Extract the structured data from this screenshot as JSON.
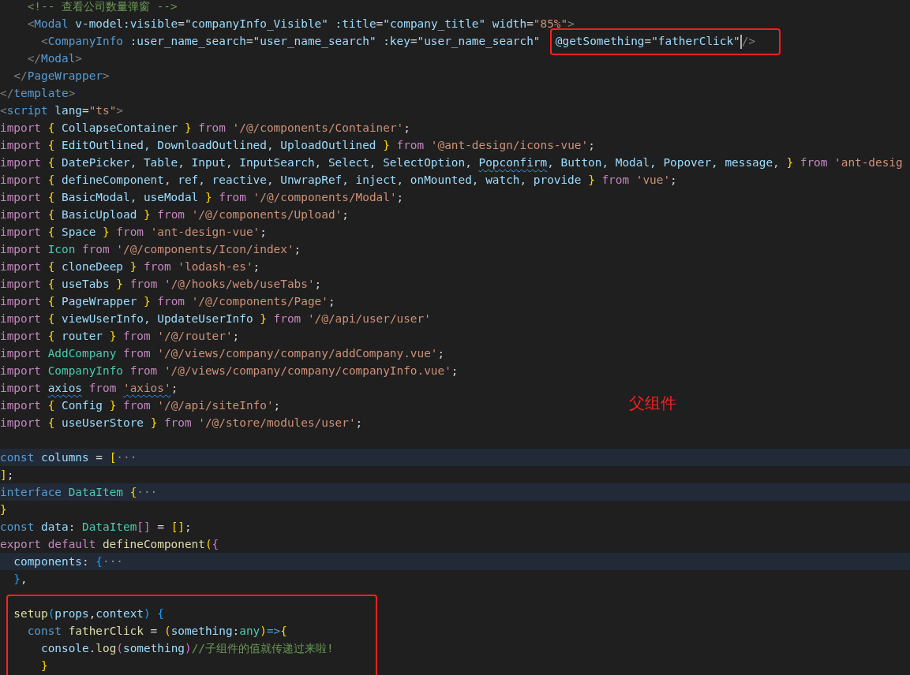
{
  "editor": {
    "lines": [
      {
        "kind": "code",
        "folded": false,
        "tokens": [
          {
            "kind": "comment",
            "text": "    <!-- 查看公司数量弹窗 -->"
          }
        ]
      },
      {
        "kind": "code",
        "folded": false,
        "tokens": [
          {
            "kind": "tagp",
            "text": "    <"
          },
          {
            "kind": "tag",
            "text": "Modal"
          },
          {
            "kind": "attr",
            "text": " v-model:visible"
          },
          {
            "kind": "punct",
            "text": "="
          },
          {
            "kind": "attr",
            "text": "\"companyInfo_Visible\""
          },
          {
            "kind": "attr",
            "text": " :title"
          },
          {
            "kind": "punct",
            "text": "="
          },
          {
            "kind": "attr",
            "text": "\"company_title\""
          },
          {
            "kind": "attr",
            "text": " width"
          },
          {
            "kind": "punct",
            "text": "="
          },
          {
            "kind": "str",
            "text": "\"85%\""
          },
          {
            "kind": "tagp",
            "text": ">"
          }
        ]
      },
      {
        "kind": "code",
        "folded": false,
        "tokens": [
          {
            "kind": "tagp",
            "text": "      <"
          },
          {
            "kind": "tag",
            "text": "CompanyInfo"
          },
          {
            "kind": "attr",
            "text": " :user_name_search"
          },
          {
            "kind": "punct",
            "text": "="
          },
          {
            "kind": "attr",
            "text": "\"user_name_search\""
          },
          {
            "kind": "attr",
            "text": " :key"
          },
          {
            "kind": "punct",
            "text": "="
          },
          {
            "kind": "attr",
            "text": "\"user_name_search\"  "
          },
          {
            "kind": "annotation_box",
            "tokens": [
              {
                "kind": "attr",
                "text": "@getSomething"
              },
              {
                "kind": "punct",
                "text": "="
              },
              {
                "kind": "attr",
                "text": "\"fatherClick\""
              },
              {
                "kind": "caret"
              },
              {
                "kind": "tagp",
                "text": "/>"
              }
            ]
          }
        ]
      },
      {
        "kind": "code",
        "folded": false,
        "tokens": [
          {
            "kind": "tagp",
            "text": "    </"
          },
          {
            "kind": "tag",
            "text": "Modal"
          },
          {
            "kind": "tagp",
            "text": ">"
          }
        ]
      },
      {
        "kind": "code",
        "folded": false,
        "tokens": [
          {
            "kind": "tagp",
            "text": "  </"
          },
          {
            "kind": "tag",
            "text": "PageWrapper"
          },
          {
            "kind": "tagp",
            "text": ">"
          }
        ]
      },
      {
        "kind": "code",
        "folded": false,
        "tokens": [
          {
            "kind": "tagp",
            "text": "</"
          },
          {
            "kind": "tag",
            "text": "template"
          },
          {
            "kind": "tagp",
            "text": ">"
          }
        ]
      },
      {
        "kind": "code",
        "folded": false,
        "tokens": [
          {
            "kind": "tagp",
            "text": "<"
          },
          {
            "kind": "tag",
            "text": "script"
          },
          {
            "kind": "attr",
            "text": " lang"
          },
          {
            "kind": "punct",
            "text": "="
          },
          {
            "kind": "str",
            "text": "\"ts\""
          },
          {
            "kind": "tagp",
            "text": ">"
          }
        ]
      },
      {
        "kind": "code",
        "folded": false,
        "tokens": [
          {
            "kind": "kw",
            "text": "import "
          },
          {
            "kind": "b1",
            "text": "{"
          },
          {
            "kind": "ident",
            "text": " CollapseContainer "
          },
          {
            "kind": "b1",
            "text": "}"
          },
          {
            "kind": "kw",
            "text": " from"
          },
          {
            "kind": "str",
            "text": " '/@/components/Container'"
          },
          {
            "kind": "punct",
            "text": ";"
          }
        ]
      },
      {
        "kind": "code",
        "folded": false,
        "tokens": [
          {
            "kind": "kw",
            "text": "import "
          },
          {
            "kind": "b1",
            "text": "{"
          },
          {
            "kind": "ident",
            "text": " EditOutlined, DownloadOutlined, UploadOutlined "
          },
          {
            "kind": "b1",
            "text": "}"
          },
          {
            "kind": "kw",
            "text": " from"
          },
          {
            "kind": "str",
            "text": " '@ant-design/icons-vue'"
          },
          {
            "kind": "punct",
            "text": ";"
          }
        ]
      },
      {
        "kind": "code",
        "folded": false,
        "tokens": [
          {
            "kind": "kw",
            "text": "import "
          },
          {
            "kind": "b1",
            "text": "{"
          },
          {
            "kind": "ident",
            "text": " DatePicker, Table, Input, InputSearch, Select, SelectOption, "
          },
          {
            "kind": "ident",
            "text": "Popconfirm",
            "squiggly": true
          },
          {
            "kind": "ident",
            "text": ", Button, Modal, Popover, message, "
          },
          {
            "kind": "b1",
            "text": "}"
          },
          {
            "kind": "kw",
            "text": " from"
          },
          {
            "kind": "str",
            "text": " 'ant-desig"
          }
        ]
      },
      {
        "kind": "code",
        "folded": false,
        "tokens": [
          {
            "kind": "kw",
            "text": "import "
          },
          {
            "kind": "b1",
            "text": "{"
          },
          {
            "kind": "ident",
            "text": " defineComponent, ref, reactive, UnwrapRef, inject, onMounted, watch, provide "
          },
          {
            "kind": "b1",
            "text": "}"
          },
          {
            "kind": "kw",
            "text": " from"
          },
          {
            "kind": "str",
            "text": " 'vue'"
          },
          {
            "kind": "punct",
            "text": ";"
          }
        ]
      },
      {
        "kind": "code",
        "folded": false,
        "tokens": [
          {
            "kind": "kw",
            "text": "import "
          },
          {
            "kind": "b1",
            "text": "{"
          },
          {
            "kind": "ident",
            "text": " BasicModal, useModal "
          },
          {
            "kind": "b1",
            "text": "}"
          },
          {
            "kind": "kw",
            "text": " from"
          },
          {
            "kind": "str",
            "text": " '/@/components/Modal'"
          },
          {
            "kind": "punct",
            "text": ";"
          }
        ]
      },
      {
        "kind": "code",
        "folded": false,
        "tokens": [
          {
            "kind": "kw",
            "text": "import "
          },
          {
            "kind": "b1",
            "text": "{"
          },
          {
            "kind": "ident",
            "text": " BasicUpload "
          },
          {
            "kind": "b1",
            "text": "}"
          },
          {
            "kind": "kw",
            "text": " from"
          },
          {
            "kind": "str",
            "text": " '/@/components/Upload'"
          },
          {
            "kind": "punct",
            "text": ";"
          }
        ]
      },
      {
        "kind": "code",
        "folded": false,
        "tokens": [
          {
            "kind": "kw",
            "text": "import "
          },
          {
            "kind": "b1",
            "text": "{"
          },
          {
            "kind": "ident",
            "text": " Space "
          },
          {
            "kind": "b1",
            "text": "}"
          },
          {
            "kind": "kw",
            "text": " from"
          },
          {
            "kind": "str",
            "text": " 'ant-design-vue'"
          },
          {
            "kind": "punct",
            "text": ";"
          }
        ]
      },
      {
        "kind": "code",
        "folded": false,
        "tokens": [
          {
            "kind": "kw",
            "text": "import "
          },
          {
            "kind": "type",
            "text": "Icon"
          },
          {
            "kind": "kw",
            "text": " from"
          },
          {
            "kind": "str",
            "text": " '/@/components/Icon/index'"
          },
          {
            "kind": "punct",
            "text": ";"
          }
        ]
      },
      {
        "kind": "code",
        "folded": false,
        "tokens": [
          {
            "kind": "kw",
            "text": "import "
          },
          {
            "kind": "b1",
            "text": "{"
          },
          {
            "kind": "ident",
            "text": " cloneDeep "
          },
          {
            "kind": "b1",
            "text": "}"
          },
          {
            "kind": "kw",
            "text": " from"
          },
          {
            "kind": "str",
            "text": " 'lodash-es'"
          },
          {
            "kind": "punct",
            "text": ";"
          }
        ]
      },
      {
        "kind": "code",
        "folded": false,
        "tokens": [
          {
            "kind": "kw",
            "text": "import "
          },
          {
            "kind": "b1",
            "text": "{"
          },
          {
            "kind": "ident",
            "text": " useTabs "
          },
          {
            "kind": "b1",
            "text": "}"
          },
          {
            "kind": "kw",
            "text": " from"
          },
          {
            "kind": "str",
            "text": " '/@/hooks/web/useTabs'"
          },
          {
            "kind": "punct",
            "text": ";"
          }
        ]
      },
      {
        "kind": "code",
        "folded": false,
        "tokens": [
          {
            "kind": "kw",
            "text": "import "
          },
          {
            "kind": "b1",
            "text": "{"
          },
          {
            "kind": "ident",
            "text": " PageWrapper "
          },
          {
            "kind": "b1",
            "text": "}"
          },
          {
            "kind": "kw",
            "text": " from"
          },
          {
            "kind": "str",
            "text": " '/@/components/Page'"
          },
          {
            "kind": "punct",
            "text": ";"
          }
        ]
      },
      {
        "kind": "code",
        "folded": false,
        "tokens": [
          {
            "kind": "kw",
            "text": "import "
          },
          {
            "kind": "b1",
            "text": "{"
          },
          {
            "kind": "ident",
            "text": " viewUserInfo, UpdateUserInfo "
          },
          {
            "kind": "b1",
            "text": "}"
          },
          {
            "kind": "kw",
            "text": " from"
          },
          {
            "kind": "str",
            "text": " '/@/api/user/user'"
          }
        ]
      },
      {
        "kind": "code",
        "folded": false,
        "tokens": [
          {
            "kind": "kw",
            "text": "import "
          },
          {
            "kind": "b1",
            "text": "{"
          },
          {
            "kind": "ident",
            "text": " router "
          },
          {
            "kind": "b1",
            "text": "}"
          },
          {
            "kind": "kw",
            "text": " from"
          },
          {
            "kind": "str",
            "text": " '/@/router'"
          },
          {
            "kind": "punct",
            "text": ";"
          }
        ]
      },
      {
        "kind": "code",
        "folded": false,
        "tokens": [
          {
            "kind": "kw",
            "text": "import "
          },
          {
            "kind": "type",
            "text": "AddCompany"
          },
          {
            "kind": "kw",
            "text": " from"
          },
          {
            "kind": "str",
            "text": " '/@/views/company/company/addCompany.vue'"
          },
          {
            "kind": "punct",
            "text": ";"
          }
        ]
      },
      {
        "kind": "code",
        "folded": false,
        "tokens": [
          {
            "kind": "kw",
            "text": "import "
          },
          {
            "kind": "type",
            "text": "CompanyInfo"
          },
          {
            "kind": "kw",
            "text": " from"
          },
          {
            "kind": "str",
            "text": " '/@/views/company/company/companyInfo.vue'"
          },
          {
            "kind": "punct",
            "text": ";"
          }
        ]
      },
      {
        "kind": "code",
        "folded": false,
        "tokens": [
          {
            "kind": "kw",
            "text": "import "
          },
          {
            "kind": "ident",
            "text": "axios",
            "squiggly": true
          },
          {
            "kind": "kw",
            "text": " from "
          },
          {
            "kind": "str",
            "text": "'axios'",
            "squiggly": true
          },
          {
            "kind": "punct",
            "text": ";"
          }
        ]
      },
      {
        "kind": "code",
        "folded": false,
        "tokens": [
          {
            "kind": "kw",
            "text": "import "
          },
          {
            "kind": "b1",
            "text": "{"
          },
          {
            "kind": "ident",
            "text": " Config "
          },
          {
            "kind": "b1",
            "text": "}"
          },
          {
            "kind": "kw",
            "text": " from"
          },
          {
            "kind": "str",
            "text": " '/@/api/siteInfo'"
          },
          {
            "kind": "punct",
            "text": ";"
          }
        ]
      },
      {
        "kind": "code",
        "folded": false,
        "tokens": [
          {
            "kind": "kw",
            "text": "import "
          },
          {
            "kind": "b1",
            "text": "{"
          },
          {
            "kind": "ident",
            "text": " useUserStore "
          },
          {
            "kind": "b1",
            "text": "}"
          },
          {
            "kind": "kw",
            "text": " from"
          },
          {
            "kind": "str",
            "text": " '/@/store/modules/user'"
          },
          {
            "kind": "punct",
            "text": ";"
          }
        ]
      },
      {
        "kind": "blank"
      },
      {
        "kind": "code",
        "folded": true,
        "tokens": [
          {
            "kind": "decl",
            "text": "const"
          },
          {
            "kind": "ident",
            "text": " columns"
          },
          {
            "kind": "punct",
            "text": " = "
          },
          {
            "kind": "b1",
            "text": "["
          },
          {
            "kind": "fold",
            "text": "···"
          }
        ]
      },
      {
        "kind": "code",
        "folded": false,
        "tokens": [
          {
            "kind": "b1",
            "text": "]"
          },
          {
            "kind": "punct",
            "text": ";"
          }
        ]
      },
      {
        "kind": "code",
        "folded": true,
        "tokens": [
          {
            "kind": "decl",
            "text": "interface"
          },
          {
            "kind": "type",
            "text": " DataItem "
          },
          {
            "kind": "b1",
            "text": "{"
          },
          {
            "kind": "fold",
            "text": "···"
          }
        ]
      },
      {
        "kind": "code",
        "folded": false,
        "tokens": [
          {
            "kind": "b1",
            "text": "}"
          }
        ]
      },
      {
        "kind": "code",
        "folded": false,
        "tokens": [
          {
            "kind": "decl",
            "text": "const"
          },
          {
            "kind": "ident",
            "text": " data"
          },
          {
            "kind": "punct",
            "text": ": "
          },
          {
            "kind": "type",
            "text": "DataItem"
          },
          {
            "kind": "b2",
            "text": "[]"
          },
          {
            "kind": "punct",
            "text": " = "
          },
          {
            "kind": "b1",
            "text": "[]"
          },
          {
            "kind": "punct",
            "text": ";"
          }
        ]
      },
      {
        "kind": "code",
        "folded": false,
        "tokens": [
          {
            "kind": "kw",
            "text": "export default"
          },
          {
            "kind": "fn",
            "text": " defineComponent"
          },
          {
            "kind": "b1",
            "text": "("
          },
          {
            "kind": "b2",
            "text": "{"
          }
        ]
      },
      {
        "kind": "code",
        "folded": true,
        "tokens": [
          {
            "kind": "ident",
            "text": "  components"
          },
          {
            "kind": "punct",
            "text": ": "
          },
          {
            "kind": "b3",
            "text": "{"
          },
          {
            "kind": "fold",
            "text": "···"
          }
        ]
      },
      {
        "kind": "code",
        "folded": false,
        "tokens": [
          {
            "kind": "b3",
            "text": "  }"
          },
          {
            "kind": "punct",
            "text": ","
          }
        ]
      },
      {
        "kind": "blank"
      },
      {
        "kind": "annotation_box",
        "lines": [
          {
            "kind": "code",
            "folded": false,
            "tokens": [
              {
                "kind": "fn",
                "text": "  setup"
              },
              {
                "kind": "b3",
                "text": "("
              },
              {
                "kind": "ident",
                "text": "props"
              },
              {
                "kind": "punct",
                "text": ","
              },
              {
                "kind": "ident",
                "text": "context"
              },
              {
                "kind": "b3",
                "text": ") {"
              }
            ]
          },
          {
            "kind": "code",
            "folded": false,
            "tokens": [
              {
                "kind": "decl",
                "text": "    const"
              },
              {
                "kind": "fn",
                "text": " fatherClick"
              },
              {
                "kind": "punct",
                "text": " = "
              },
              {
                "kind": "b1",
                "text": "("
              },
              {
                "kind": "ident",
                "text": "something"
              },
              {
                "kind": "punct",
                "text": ":"
              },
              {
                "kind": "type",
                "text": "any"
              },
              {
                "kind": "b1",
                "text": ")"
              },
              {
                "kind": "decl",
                "text": "=>"
              },
              {
                "kind": "b1",
                "text": "{"
              }
            ]
          },
          {
            "kind": "code",
            "folded": false,
            "tokens": [
              {
                "kind": "ident",
                "text": "      console"
              },
              {
                "kind": "punct",
                "text": "."
              },
              {
                "kind": "fn",
                "text": "log"
              },
              {
                "kind": "b2",
                "text": "("
              },
              {
                "kind": "ident",
                "text": "something"
              },
              {
                "kind": "b2",
                "text": ")"
              },
              {
                "kind": "comment",
                "text": "//子组件的值就传递过来啦!"
              }
            ]
          },
          {
            "kind": "code",
            "folded": false,
            "tokens": [
              {
                "kind": "b1",
                "text": "      }"
              }
            ]
          }
        ]
      }
    ]
  },
  "annotation_label": "父组件"
}
